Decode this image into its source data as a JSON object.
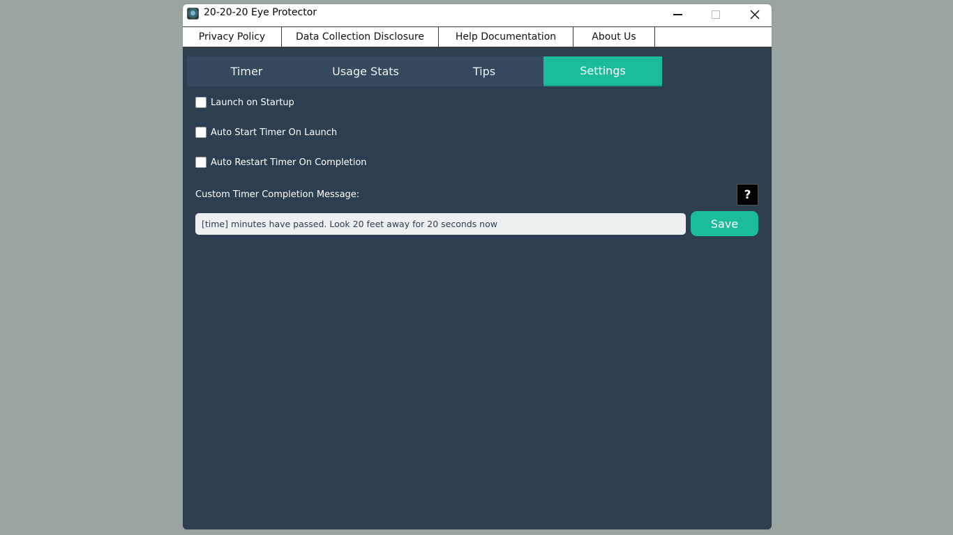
{
  "window": {
    "title": "20-20-20 Eye Protector",
    "icon": "eye-app-icon"
  },
  "menubar": {
    "items": [
      {
        "label": "Privacy Policy"
      },
      {
        "label": "Data Collection Disclosure"
      },
      {
        "label": "Help Documentation"
      },
      {
        "label": "About Us"
      }
    ]
  },
  "tabs": {
    "items": [
      {
        "label": "Timer"
      },
      {
        "label": "Usage Stats"
      },
      {
        "label": "Tips"
      },
      {
        "label": "Settings",
        "active": true
      }
    ]
  },
  "settings": {
    "launch_on_startup": {
      "label": "Launch on Startup",
      "checked": false
    },
    "auto_start": {
      "label": "Auto Start Timer On Launch",
      "checked": false
    },
    "auto_restart": {
      "label": "Auto Restart Timer On Completion",
      "checked": false
    },
    "message_label": "Custom Timer Completion Message:",
    "help_label": "?",
    "message_value": "[time] minutes have passed. Look 20 feet away for 20 seconds now",
    "save_label": "Save"
  },
  "colors": {
    "background": "#2d3e50",
    "tab": "#34495e",
    "accent": "#1abc9c",
    "desktop": "#9aa5a1"
  }
}
